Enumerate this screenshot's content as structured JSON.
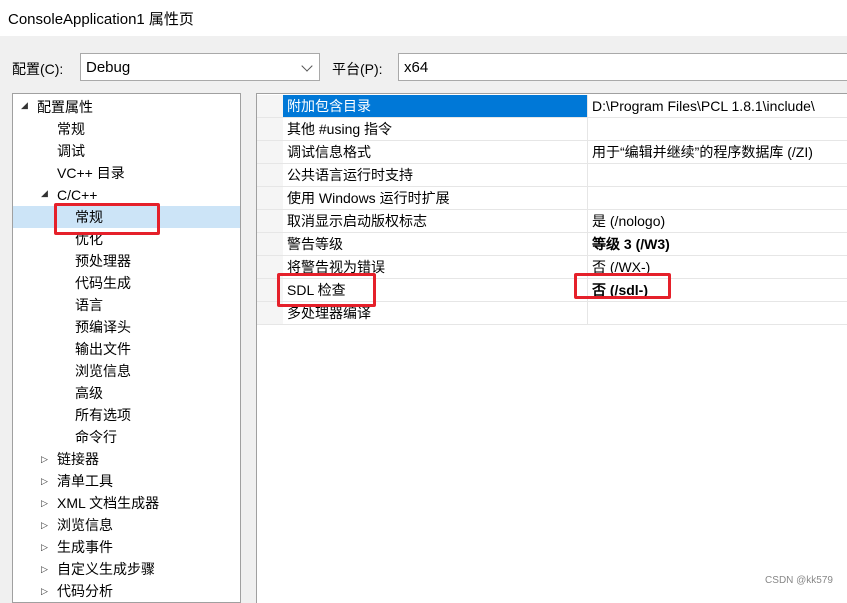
{
  "window": {
    "title": "ConsoleApplication1 属性页"
  },
  "config": {
    "config_label": "配置(C):",
    "config_value": "Debug",
    "platform_label": "平台(P):",
    "platform_value": "x64"
  },
  "tree": {
    "root": "配置属性",
    "general": "常规",
    "debugging": "调试",
    "vcdirs": "VC++ 目录",
    "cpp": "C/C++",
    "cpp_children": [
      "常规",
      "优化",
      "预处理器",
      "代码生成",
      "语言",
      "预编译头",
      "输出文件",
      "浏览信息",
      "高级",
      "所有选项",
      "命令行"
    ],
    "collapsed": [
      "链接器",
      "清单工具",
      "XML 文档生成器",
      "浏览信息",
      "生成事件",
      "自定义生成步骤",
      "代码分析"
    ]
  },
  "properties": [
    {
      "name": "附加包含目录",
      "value": "D:\\Program Files\\PCL 1.8.1\\include\\"
    },
    {
      "name": "其他 #using 指令",
      "value": ""
    },
    {
      "name": "调试信息格式",
      "value": "用于“编辑并继续”的程序数据库 (/ZI)"
    },
    {
      "name": "公共语言运行时支持",
      "value": ""
    },
    {
      "name": "使用 Windows 运行时扩展",
      "value": ""
    },
    {
      "name": "取消显示启动版权标志",
      "value": "是 (/nologo)"
    },
    {
      "name": "警告等级",
      "value": "等级 3 (/W3)"
    },
    {
      "name": "将警告视为错误",
      "value": "否 (/WX-)"
    },
    {
      "name": "SDL 检查",
      "value": "否 (/sdl-)"
    },
    {
      "name": "多处理器编译",
      "value": ""
    }
  ],
  "watermark": "CSDN @kk579",
  "colors": {
    "selection": "#0078d7",
    "tree_selection": "#cce4f7",
    "highlight_box": "#e5202a"
  }
}
